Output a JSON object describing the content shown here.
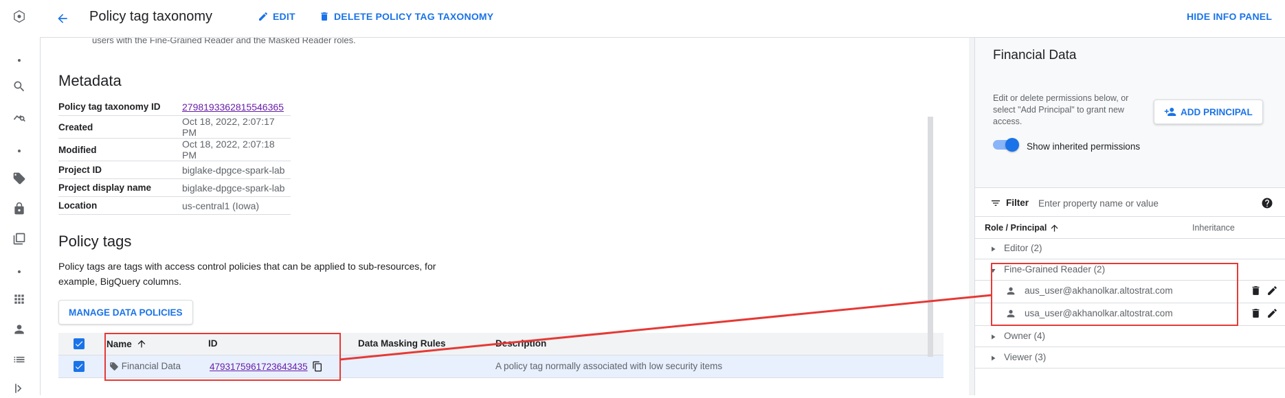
{
  "header": {
    "title": "Policy tag taxonomy",
    "edit_label": "EDIT",
    "delete_label": "DELETE POLICY TAG TAXONOMY",
    "hide_panel_label": "HIDE INFO PANEL"
  },
  "main": {
    "cut_text": "users with the Fine-Grained Reader and the Masked Reader roles.",
    "metadata_title": "Metadata",
    "metadata": [
      {
        "key": "Policy tag taxonomy ID",
        "value": "2798193362815546365"
      },
      {
        "key": "Created",
        "value": "Oct 18, 2022, 2:07:17 PM"
      },
      {
        "key": "Modified",
        "value": "Oct 18, 2022, 2:07:18 PM"
      },
      {
        "key": "Project ID",
        "value": "biglake-dpgce-spark-lab"
      },
      {
        "key": "Project display name",
        "value": "biglake-dpgce-spark-lab"
      },
      {
        "key": "Location",
        "value": "us-central1 (Iowa)"
      }
    ],
    "policy_tags_title": "Policy tags",
    "policy_tags_desc": "Policy tags are tags with access control policies that can be applied to sub-resources, for example, BigQuery columns.",
    "manage_button": "MANAGE DATA POLICIES",
    "table": {
      "headers": [
        "Name",
        "ID",
        "Data Masking Rules",
        "Description"
      ],
      "rows": [
        {
          "name": "Financial Data",
          "id": "4793175961723643435",
          "masking": "",
          "description": "A policy tag normally associated with low security items"
        }
      ]
    }
  },
  "panel": {
    "title": "Financial Data",
    "help_text": "Edit or delete permissions below, or select \"Add Principal\" to grant new access.",
    "add_principal_label": "ADD PRINCIPAL",
    "show_inherited_label": "Show inherited permissions",
    "show_inherited_on": true,
    "filter_label": "Filter",
    "filter_placeholder": "Enter property name or value",
    "col_role": "Role / Principal",
    "col_inheritance": "Inheritance",
    "roles": [
      {
        "label": "Editor (2)",
        "expanded": false
      },
      {
        "label": "Fine-Grained Reader (2)",
        "expanded": true,
        "principals": [
          "aus_user@akhanolkar.altostrat.com",
          "usa_user@akhanolkar.altostrat.com"
        ]
      },
      {
        "label": "Owner (4)",
        "expanded": false
      },
      {
        "label": "Viewer (3)",
        "expanded": false
      }
    ]
  },
  "colors": {
    "accent": "#1a73e8",
    "link": "#681da8",
    "annotation": "#e53935"
  }
}
